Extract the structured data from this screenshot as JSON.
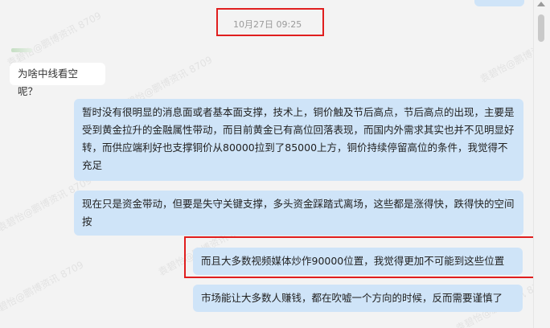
{
  "chat": {
    "timestamp": "10月27日 09:25",
    "watermark": "袁碧怡@鹏博资讯 8709",
    "messages": [
      {
        "side": "in",
        "text": "为啥中线看空呢？"
      },
      {
        "side": "out",
        "text": "暂时没有很明显的消息面或者基本面支撑，技术上，铜价触及节后高点，节后高点的出现，主要是受到黄金拉升的金融属性带动，而目前黄金已有高位回落表现，而国内外需求其实也并不见明显好转，而供应端利好也支撑铜价从80000拉到了85000上方，铜价持续停留高位的条件，我觉得不充足"
      },
      {
        "side": "out",
        "text": "现在只是资金带动，但要是失守关键支撑，多头资金踩踏式离场，这些都是涨得快，跌得快的空间按"
      },
      {
        "side": "out",
        "text": "而且大多数视频媒体炒作90000位置，我觉得更加不可能到这些位置"
      },
      {
        "side": "out",
        "text": "市场能让大多数人赚钱，都在吹嘘一个方向的时候，反而需要谨慎了"
      }
    ]
  },
  "colors": {
    "highlight": "#e01e1e",
    "outgoing_bubble": "#cfe4f8",
    "incoming_bubble": "#ffffff"
  }
}
